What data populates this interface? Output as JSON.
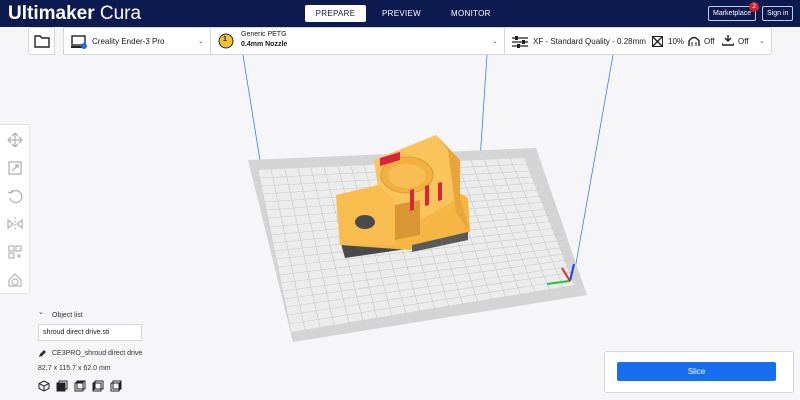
{
  "app": {
    "title_bold": "Ultimaker",
    "title_rest": " Cura"
  },
  "stages": [
    "PREPARE",
    "PREVIEW",
    "MONITOR"
  ],
  "topbar": {
    "marketplace": "Marketplace",
    "marketplace_badge": "2",
    "signin": "Sign in"
  },
  "header": {
    "printer": "Creality Ender-3 Pro",
    "material_slot": "1",
    "material": "Generic PETG",
    "nozzle": "0.4mm Nozzle",
    "profile": "XF - Standard Quality - 0.28mm",
    "infill": "10%",
    "support": "Off",
    "adhesion": "Off"
  },
  "object_list": {
    "title": "Object list",
    "selected_file": "shroud direct drive.sti",
    "job_name": "CE3PRO_shroud direct drive",
    "dimensions": "82.7 x 115.7 x 62.0 mm"
  },
  "slice": {
    "label": "Slice"
  },
  "colors": {
    "topbar": "#0d1a4f",
    "accent": "#196ef0",
    "model": "#f7b544",
    "plate": "#d6d6d6"
  },
  "icons": [
    "folder-icon",
    "printer-icon",
    "chevron-down-icon",
    "settings-sliders-icon",
    "infill-icon",
    "support-icon",
    "adhesion-icon",
    "move-icon",
    "scale-icon",
    "rotate-icon",
    "mirror-icon",
    "per-model-settings-icon",
    "support-blocker-icon",
    "edit-pencil-icon",
    "view-3d-icon",
    "view-front-icon",
    "view-top-icon",
    "view-left-icon",
    "view-right-icon"
  ]
}
